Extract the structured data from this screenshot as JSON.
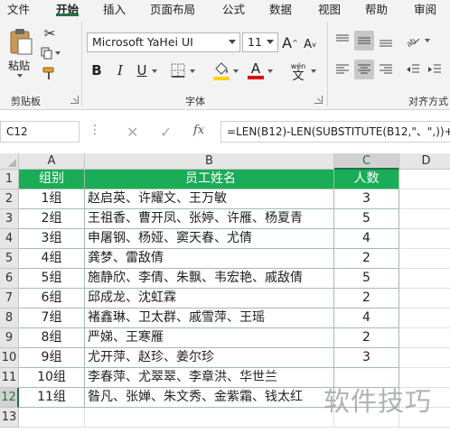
{
  "ribbon_tabs": [
    "文件",
    "开始",
    "插入",
    "页面布局",
    "公式",
    "数据",
    "视图",
    "帮助",
    "审阅"
  ],
  "ribbon": {
    "clipboard": {
      "paste_label": "粘贴",
      "group_label": "剪贴板"
    },
    "font": {
      "font_name": "Microsoft YaHei UI",
      "font_size": "11",
      "group_label": "字体",
      "bold": "B",
      "italic": "I",
      "underline": "U",
      "grow": "A",
      "shrink": "A",
      "font_color_letter": "A",
      "phonetic_top": "wén",
      "phonetic_bottom": "文"
    },
    "alignment": {
      "group_label": "对齐方式"
    }
  },
  "formula_bar": {
    "name_box": "C12",
    "fx_label": "fx",
    "formula": "=LEN(B12)-LEN(SUBSTITUTE(B12,\"、\",))+"
  },
  "sheet": {
    "columns": [
      "A",
      "B",
      "C",
      "D"
    ],
    "rows": [
      "1",
      "2",
      "3",
      "4",
      "5",
      "6",
      "7",
      "8",
      "9",
      "10",
      "11",
      "12",
      "13"
    ],
    "header": [
      "组别",
      "员工姓名",
      "人数"
    ],
    "data": [
      [
        "1组",
        "赵启英、许耀文、王万敏",
        "3"
      ],
      [
        "2组",
        "王祖香、曹开凤、张婷、许雁、杨夏青",
        "5"
      ],
      [
        "3组",
        "申屠钢、杨娅、窦天春、尤倩",
        "4"
      ],
      [
        "4组",
        "龚梦、雷敌倩",
        "2"
      ],
      [
        "5组",
        "施静欣、李倩、朱飘、韦宏艳、戚敌倩",
        "5"
      ],
      [
        "6组",
        "邱成龙、沈虹霖",
        "2"
      ],
      [
        "7组",
        "褚鑫琳、卫太群、戚雪萍、王瑶",
        "4"
      ],
      [
        "8组",
        "严娣、王寒雁",
        "2"
      ],
      [
        "9组",
        "尤开萍、赵珍、姜尔珍",
        "3"
      ],
      [
        "10组",
        "李春萍、尤翠翠、李章洪、华世兰",
        ""
      ],
      [
        "11组",
        "昝凡、张婵、朱文秀、金紫霜、钱太红",
        ""
      ]
    ]
  },
  "watermark": "软件技巧",
  "colors": {
    "accent": "#217346",
    "header_fill": "#1aac57",
    "font_color_bar": "#e00000",
    "highlight_bar": "#ffd400"
  }
}
